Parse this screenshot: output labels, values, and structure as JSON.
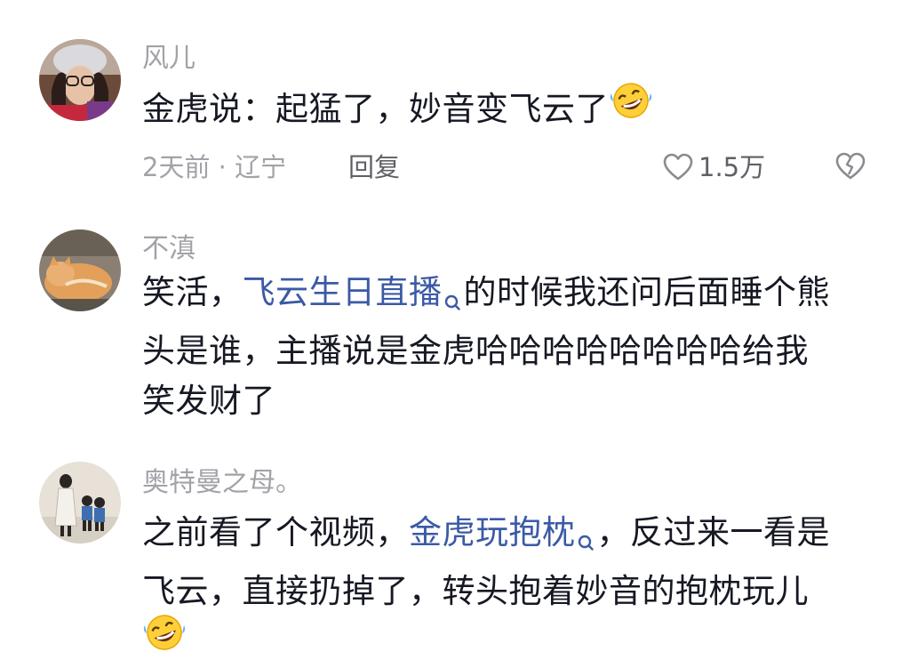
{
  "comments": [
    {
      "username": "风儿",
      "lines": [
        {
          "parts": [
            {
              "text": "金虎说：起猛了，妙音变飞云了"
            }
          ],
          "emoji": "rofl-emoji"
        }
      ],
      "time": "2天前 · 辽宁",
      "reply_label": "回复",
      "likes": "1.5万"
    },
    {
      "username": "不滇",
      "lines": [
        {
          "parts": [
            {
              "text": "笑活，"
            },
            {
              "text": "飞云生日直播",
              "link": true
            },
            {
              "text": "的时候我还问后面睡个熊"
            }
          ]
        },
        {
          "parts": [
            {
              "text": "头是谁，主播说是金虎哈哈哈哈哈哈哈哈给我"
            }
          ]
        },
        {
          "parts": [
            {
              "text": "笑发财了"
            }
          ]
        }
      ]
    },
    {
      "username": "奥特曼之母。",
      "lines": [
        {
          "parts": [
            {
              "text": "之前看了个视频，"
            },
            {
              "text": "金虎玩抱枕",
              "link": true
            },
            {
              "text": "，反过来一看是"
            }
          ]
        },
        {
          "parts": [
            {
              "text": "飞云，直接扔掉了，转头抱着妙音的抱枕玩儿"
            }
          ]
        },
        {
          "parts": [],
          "emoji": "rofl-emoji"
        }
      ]
    }
  ],
  "icons": {
    "like": "heart-outline-icon",
    "dislike": "broken-heart-icon",
    "search": "search-icon",
    "emoji": "rofl-emoji"
  },
  "colors": {
    "text": "#161823",
    "secondary": "#a2a2a8",
    "action": "#5f5f66",
    "link": "#3b5aa6"
  }
}
